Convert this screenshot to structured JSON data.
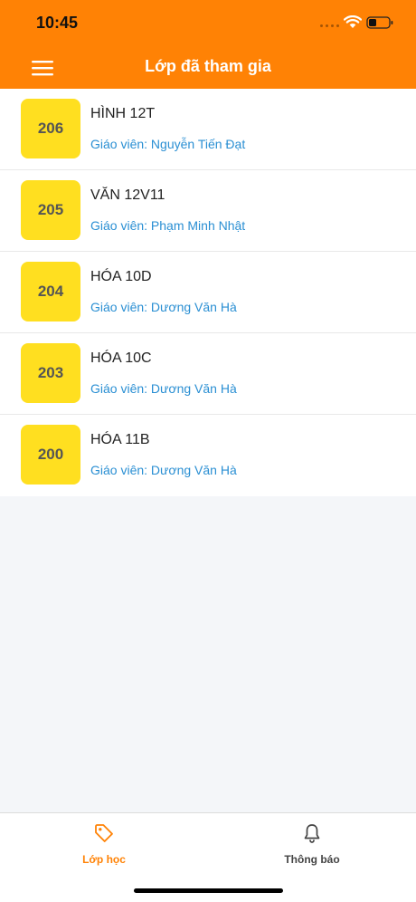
{
  "status_bar": {
    "time": "10:45"
  },
  "header": {
    "title": "Lớp đã tham gia"
  },
  "teacher_prefix": "Giáo viên:",
  "classes": [
    {
      "code": "206",
      "name": "HÌNH 12T",
      "teacher": "Giáo viên: Nguyễn Tiến Đạt"
    },
    {
      "code": "205",
      "name": "VĂN 12V11",
      "teacher": "Giáo viên: Phạm Minh Nhật"
    },
    {
      "code": "204",
      "name": "HÓA 10D",
      "teacher": "Giáo viên: Dương Văn Hà"
    },
    {
      "code": "203",
      "name": "HÓA 10C",
      "teacher": "Giáo viên: Dương Văn Hà"
    },
    {
      "code": "200",
      "name": "HÓA 11B",
      "teacher": "Giáo viên: Dương Văn Hà"
    }
  ],
  "tabs": [
    {
      "label": "Lớp học",
      "icon": "tag-icon",
      "active": true
    },
    {
      "label": "Thông báo",
      "icon": "bell-icon",
      "active": false
    }
  ],
  "colors": {
    "header": "#ff8205",
    "badge": "#ffdf20",
    "teacher_text": "#2a8fd3",
    "active_tab": "#ff8205"
  }
}
